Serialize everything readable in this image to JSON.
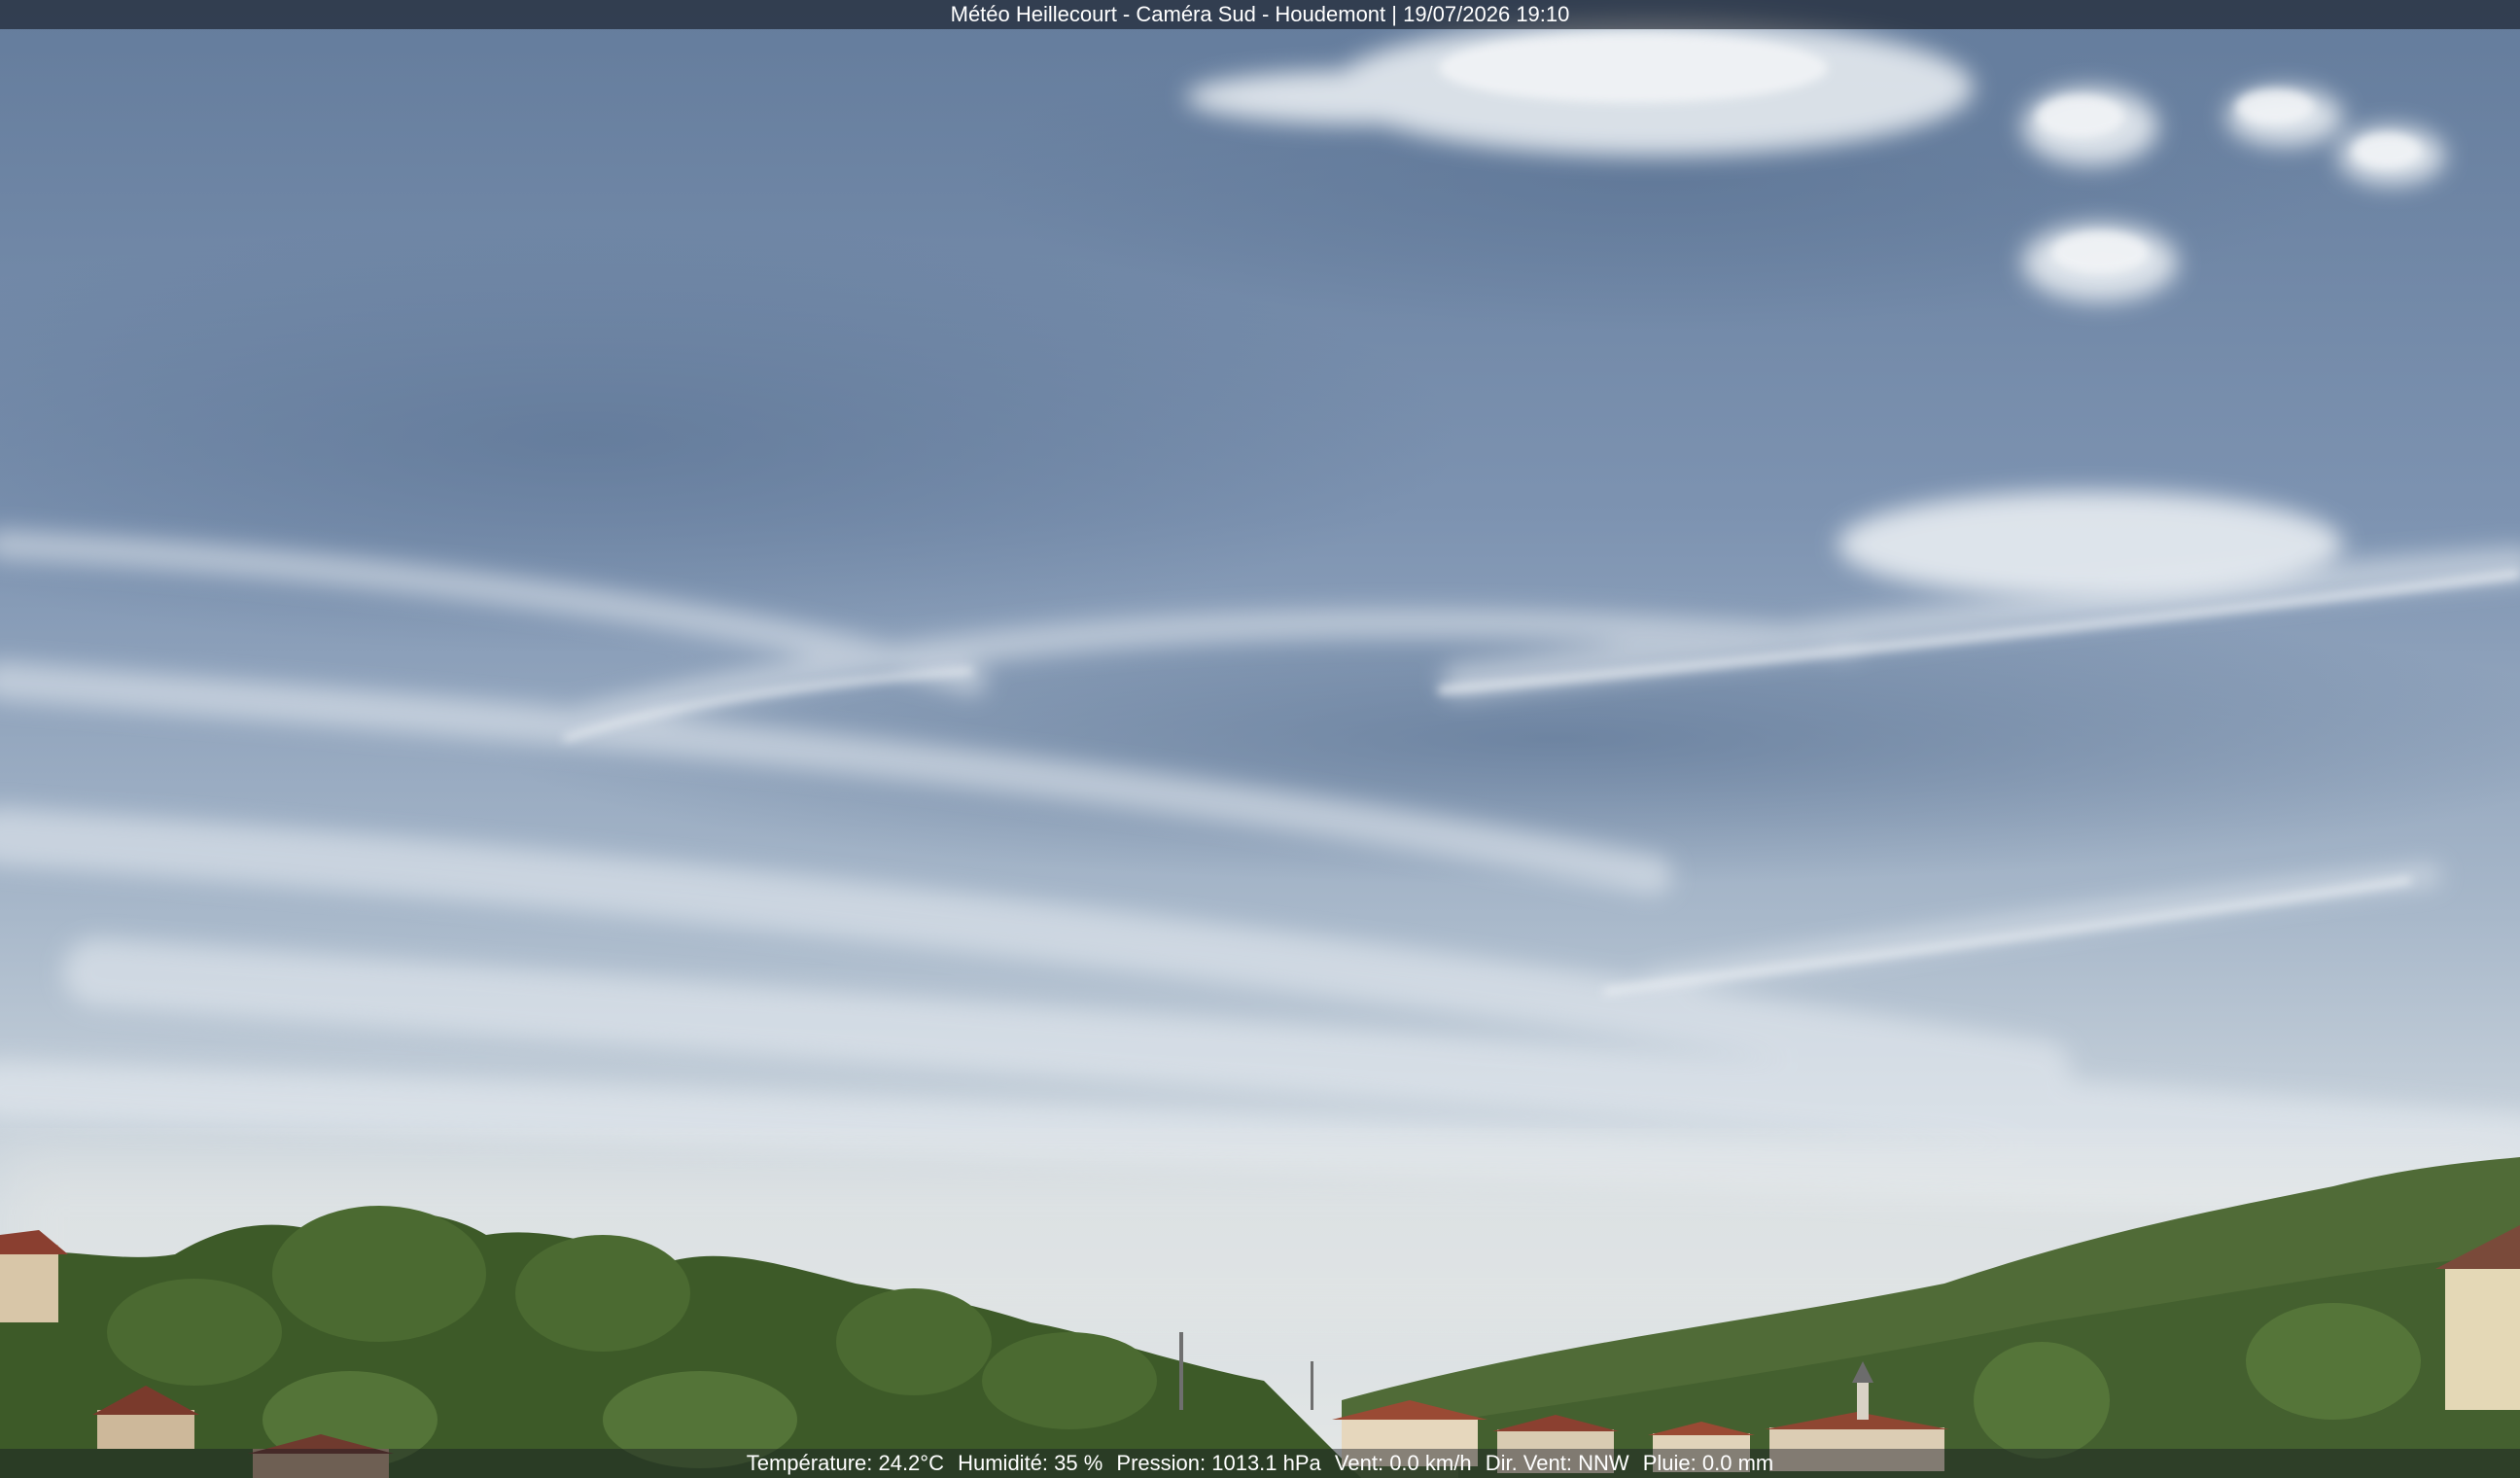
{
  "overlay": {
    "title": "Météo Heillecourt - Caméra Sud - Houdemont | 19/07/2026 19:10",
    "status": {
      "temperature": "Température: 24.2°C",
      "humidity": "Humidité: 35 %",
      "pressure": "Pression: 1013.1 hPa",
      "wind": "Vent: 0.0 km/h",
      "wind_dir": "Dir. Vent: NNW",
      "rain": "Pluie: 0.0 mm"
    }
  },
  "colors": {
    "sky_top": "#62799a",
    "sky_mid": "#8ea3bd",
    "sky_horizon": "#dde3e6",
    "trees": "#3f5a2a",
    "hill": "#4f6a35",
    "roof": "#9a4a34"
  }
}
